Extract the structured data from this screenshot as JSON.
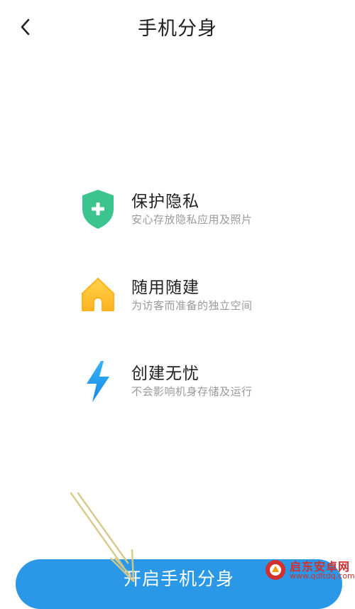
{
  "header": {
    "title": "手机分身",
    "back_icon": "chevron-left-icon"
  },
  "features": [
    {
      "title": "保护隐私",
      "description": "安心存放隐私应用及照片",
      "icon": "shield-plus-icon",
      "color": "#3cc48e"
    },
    {
      "title": "随用随建",
      "description": "为访客而准备的独立空间",
      "icon": "house-icon",
      "color": "#ffc233"
    },
    {
      "title": "创建无忧",
      "description": "不会影响机身存储及运行",
      "icon": "lightning-icon",
      "color": "#2196f3"
    }
  ],
  "primary_button": {
    "label": "开启手机分身",
    "color": "#2a98e6"
  },
  "watermark": {
    "name": "启东安卓网",
    "url": "www.qdltdq.com",
    "color": "#d32f2f"
  }
}
